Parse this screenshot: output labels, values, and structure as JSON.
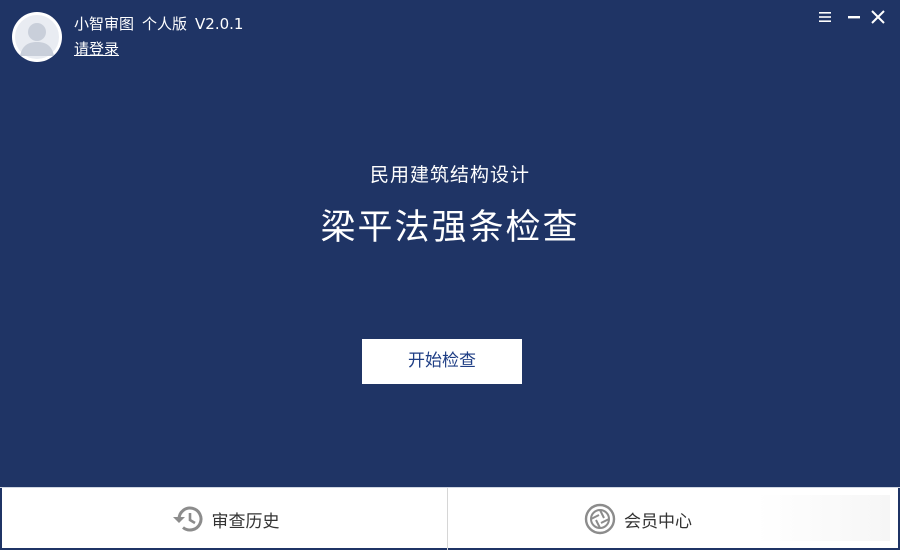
{
  "header": {
    "app_name": "小智审图",
    "edition": "个人版",
    "version": "V2.0.1",
    "login_link": "请登录",
    "avatar_icon": "user-silhouette-icon",
    "menu_icon": "hamburger-menu-icon",
    "minimize_icon": "minimize-icon",
    "close_icon": "close-icon"
  },
  "main": {
    "subtitle": "民用建筑结构设计",
    "headline": "梁平法强条检查",
    "start_button": "开始检查"
  },
  "bottom_bar": {
    "history": {
      "label": "审查历史",
      "icon": "history-clock-icon"
    },
    "member": {
      "label": "会员中心",
      "icon": "member-aperture-icon"
    }
  },
  "colors": {
    "background": "#1f3465",
    "button_text": "#1f3e85",
    "footer_text": "#333333"
  }
}
